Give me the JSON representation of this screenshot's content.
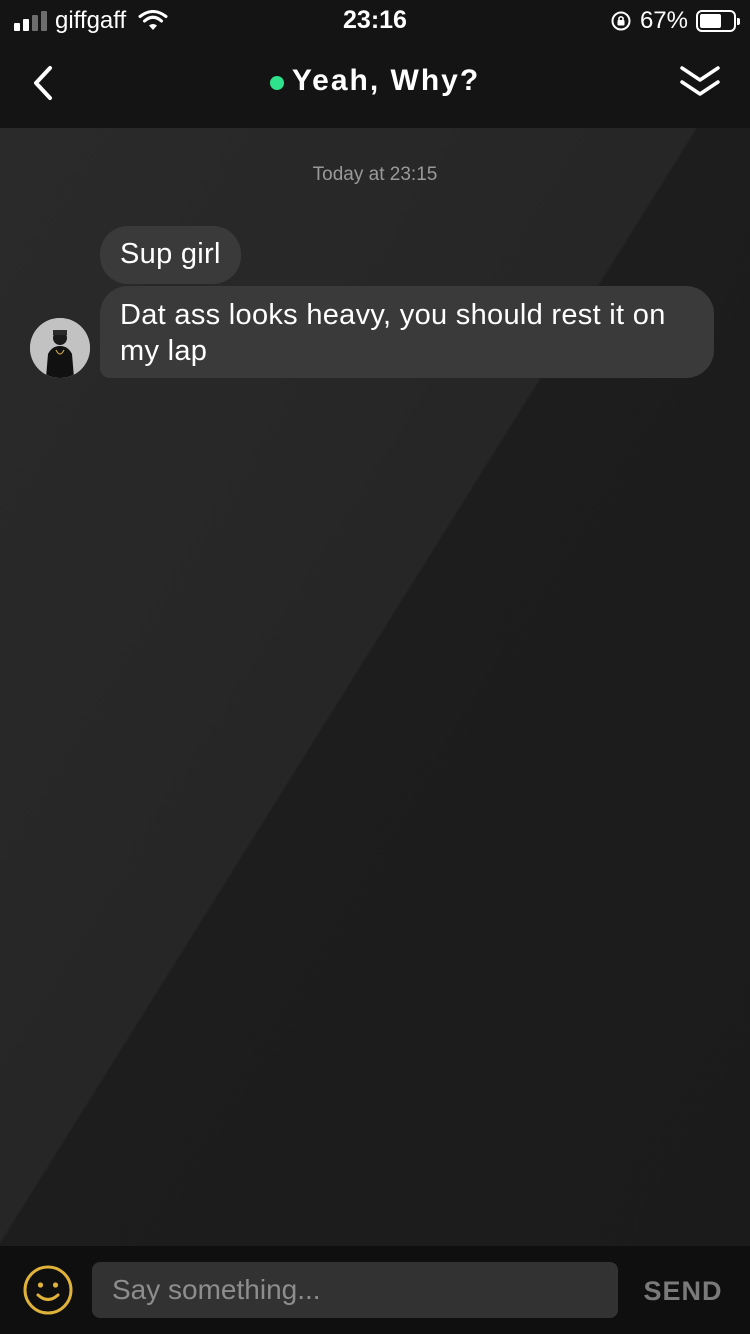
{
  "status_bar": {
    "carrier": "giffgaff",
    "time": "23:16",
    "battery_percent": "67%",
    "battery_level": 0.67,
    "signal_bars_active": 2,
    "signal_bars_total": 4
  },
  "header": {
    "title": "Yeah, Why?",
    "online_color": "#2ee38c"
  },
  "chat": {
    "timestamp": "Today at 23:15",
    "messages": [
      {
        "text": "Sup girl"
      },
      {
        "text": "Dat ass looks heavy, you should rest it on my lap"
      }
    ]
  },
  "composer": {
    "placeholder": "Say something...",
    "send_label": "SEND",
    "emoji_color": "#e0b23a"
  }
}
